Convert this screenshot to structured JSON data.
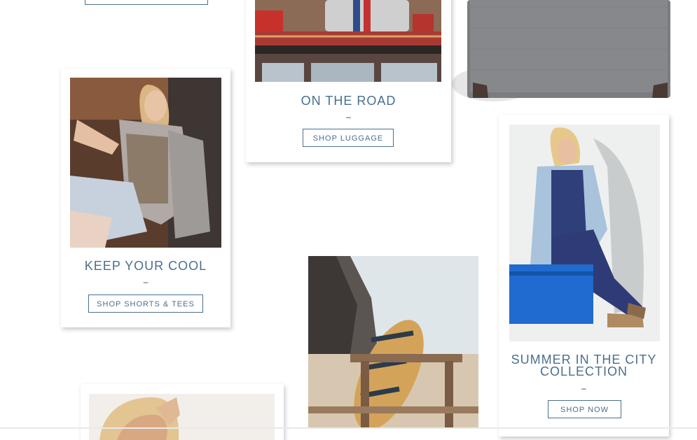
{
  "cards": {
    "on_the_road": {
      "title": "ON THE ROAD",
      "dash": "–",
      "button": "SHOP LUGGAGE"
    },
    "keep_your_cool": {
      "title": "KEEP YOUR COOL",
      "dash": "–",
      "button": "SHOP SHORTS & TEES"
    },
    "summer_city": {
      "title_line1": "SUMMER IN THE CITY",
      "title_line2": "COLLECTION",
      "dash": "–",
      "button": "SHOP NOW"
    }
  },
  "colors": {
    "accent": "#4b6f8e",
    "background": "#ffffff"
  }
}
